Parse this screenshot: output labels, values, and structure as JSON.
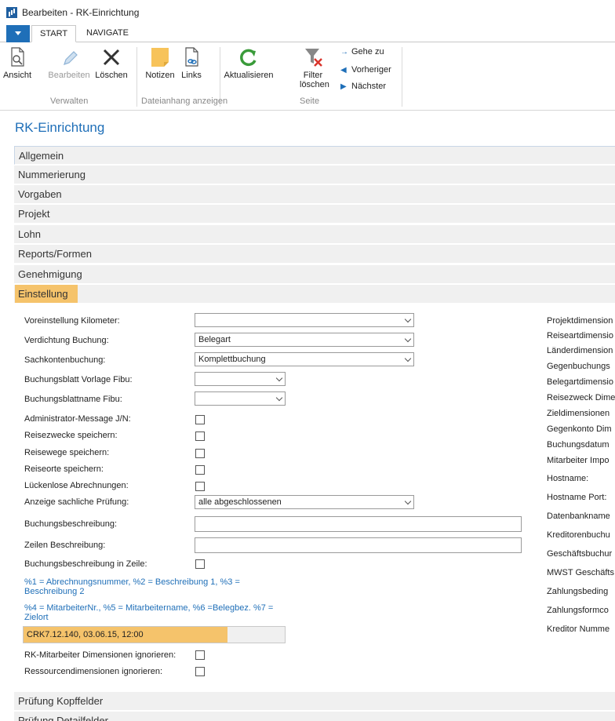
{
  "window": {
    "title": "Bearbeiten - RK-Einrichtung"
  },
  "ribbon_tabs": {
    "start": "START",
    "navigate": "NAVIGATE"
  },
  "ribbon": {
    "ansicht": "Ansicht",
    "bearbeiten": "Bearbeiten",
    "loeschen": "Löschen",
    "notizen": "Notizen",
    "links": "Links",
    "aktualisieren": "Aktualisieren",
    "filter_loeschen_1": "Filter",
    "filter_loeschen_2": "löschen",
    "gehe_zu": "Gehe zu",
    "vorheriger": "Vorheriger",
    "naechster": "Nächster",
    "group_verwalten": "Verwalten",
    "group_dateianhang": "Dateianhang anzeigen",
    "group_seite": "Seite"
  },
  "page": {
    "title": "RK-Einrichtung"
  },
  "sections": {
    "allgemein": "Allgemein",
    "nummerierung": "Nummerierung",
    "vorgaben": "Vorgaben",
    "projekt": "Projekt",
    "lohn": "Lohn",
    "reports": "Reports/Formen",
    "genehmigung": "Genehmigung",
    "einstellung": "Einstellung",
    "pruefung_kopf": "Prüfung Kopffelder",
    "pruefung_detail": "Prüfung Detailfelder"
  },
  "einstellung": {
    "voreinstellung_km": {
      "label": "Voreinstellung Kilometer:",
      "value": ""
    },
    "verdichtung": {
      "label": "Verdichtung Buchung:",
      "value": "Belegart"
    },
    "sachkonten": {
      "label": "Sachkontenbuchung:",
      "value": "Komplettbuchung"
    },
    "bb_vorlage": {
      "label": "Buchungsblatt Vorlage Fibu:",
      "value": ""
    },
    "bb_name": {
      "label": "Buchungsblattname Fibu:",
      "value": ""
    },
    "admin_msg": {
      "label": "Administrator-Message J/N:"
    },
    "reisezwecke": {
      "label": "Reisezwecke speichern:"
    },
    "reisewege": {
      "label": "Reisewege speichern:"
    },
    "reiseorte": {
      "label": "Reiseorte speichern:"
    },
    "lueckenlose": {
      "label": "Lückenlose Abrechnungen:"
    },
    "anzeige_pruefung": {
      "label": "Anzeige sachliche Prüfung:",
      "value": "alle abgeschlossenen"
    },
    "buchungsbeschreibung": {
      "label": "Buchungsbeschreibung:",
      "value": ""
    },
    "zeilen_beschreibung": {
      "label": "Zeilen Beschreibung:",
      "value": ""
    },
    "bb_in_zeile": {
      "label": "Buchungsbeschreibung in Zeile:"
    },
    "hint1_a": "%1 = Abrechnungsnummer, %2 = Beschreibung 1, %3 =",
    "hint1_b": "Beschreibung 2",
    "hint2_a": "%4 = MitarbeiterNr., %5 = Mitarbeitername, %6 =Belegbez. %7 =",
    "hint2_b": "Zielort",
    "version": "CRK7.12.140, 03.06.15, 12:00",
    "rk_ma_dim": {
      "label": "RK-Mitarbeiter Dimensionen ignorieren:"
    },
    "ressourcen_dim": {
      "label": "Ressourcendimensionen ignorieren:"
    }
  },
  "right_labels": [
    "Projektdimension",
    "Reiseartdimensio",
    "Länderdimension",
    "Gegenbuchungs",
    "Belegartdimensio",
    "Reisezweck Dime",
    "Zieldimensionen",
    "Gegenkonto Dim",
    "Buchungsdatum",
    "Mitarbeiter Impo",
    "Hostname:",
    "Hostname Port:",
    "Datenbankname",
    "Kreditorenbuchu",
    "Geschäftsbuchur",
    "MWST Geschäfts",
    "Zahlungsbeding",
    "Zahlungsformco",
    "Kreditor Numme"
  ]
}
